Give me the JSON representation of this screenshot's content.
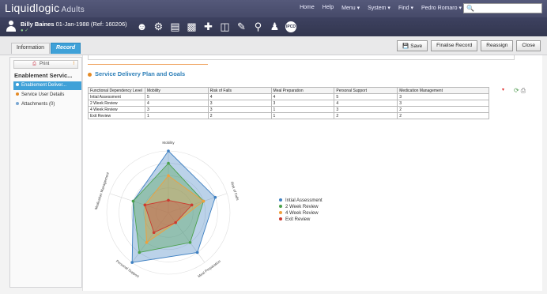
{
  "app": {
    "name": "Liquidlogic",
    "module": "Adults"
  },
  "topnav": [
    "Home",
    "Help",
    "Menu ▾",
    "System ▾",
    "Find ▾",
    "Pedro Romaro ▾"
  ],
  "patient": {
    "name": "Billy Baines",
    "details": "01-Jan-1988 (Ref: 160206)"
  },
  "tabs": {
    "information": "Information",
    "record": "Record"
  },
  "actions": {
    "save": "Save",
    "finalise": "Finalise Record",
    "reassign": "Reassign",
    "close": "Close"
  },
  "sidebar": {
    "print": "Print",
    "title": "Enablement Servic...",
    "items": [
      {
        "label": "Enablement Deliver..."
      },
      {
        "label": "Service User Details"
      },
      {
        "label": "Attachments (0)"
      }
    ]
  },
  "main": {
    "section_title": "Service Delivery Plan and Goals"
  },
  "table": {
    "headers": [
      "Functional Dependency Level",
      "Mobility",
      "Risk of Falls",
      "Meal Preparation",
      "Personal Support",
      "Medication Management"
    ],
    "rows": [
      [
        "Intial Assessment",
        "5",
        "4",
        "4",
        "5",
        "3"
      ],
      [
        "2 Week Review",
        "4",
        "3",
        "3",
        "4",
        "3"
      ],
      [
        "4 Week Review",
        "3",
        "3",
        "1",
        "3",
        "2"
      ],
      [
        "Exit Review",
        "1",
        "2",
        "1",
        "2",
        "2"
      ]
    ]
  },
  "chart_data": {
    "type": "radar",
    "axes": [
      "Mobility",
      "Risk of Falls",
      "Meal Preparation",
      "Personal Support",
      "Medication Management"
    ],
    "range": [
      0,
      5
    ],
    "series": [
      {
        "name": "Intial Assessment",
        "values": [
          5,
          4,
          4,
          5,
          3
        ],
        "color": "#3d7fc1"
      },
      {
        "name": "2 Week Review",
        "values": [
          4,
          3,
          3,
          4,
          3
        ],
        "color": "#4aa14a"
      },
      {
        "name": "4 Week Review",
        "values": [
          3,
          3,
          1,
          3,
          2
        ],
        "color": "#f0a03c"
      },
      {
        "name": "Exit Review",
        "values": [
          1,
          2,
          1,
          2,
          2
        ],
        "color": "#cc3b30"
      }
    ]
  }
}
